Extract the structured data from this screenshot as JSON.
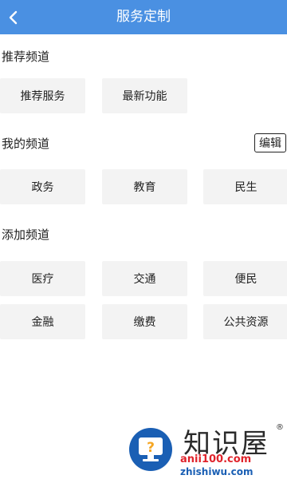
{
  "header": {
    "title": "服务定制",
    "back_icon": "chevron-left-icon"
  },
  "recommended": {
    "title": "推荐频道",
    "items": [
      "推荐服务",
      "最新功能"
    ]
  },
  "mine": {
    "title": "我的频道",
    "edit_label": "编辑",
    "items": [
      "政务",
      "教育",
      "民生"
    ]
  },
  "add": {
    "title": "添加频道",
    "items": [
      "医疗",
      "交通",
      "便民",
      "金融",
      "缴费",
      "公共资源"
    ]
  },
  "watermark": {
    "brand": "知识屋",
    "reg": "®",
    "url": "anii100.com",
    "pinyin": "zhishiwu.com"
  },
  "colors": {
    "header_bg": "#4a90e2",
    "tile_bg": "#f3f3f3",
    "watermark_blue": "#1a5fb4",
    "watermark_red": "#e0232b"
  }
}
